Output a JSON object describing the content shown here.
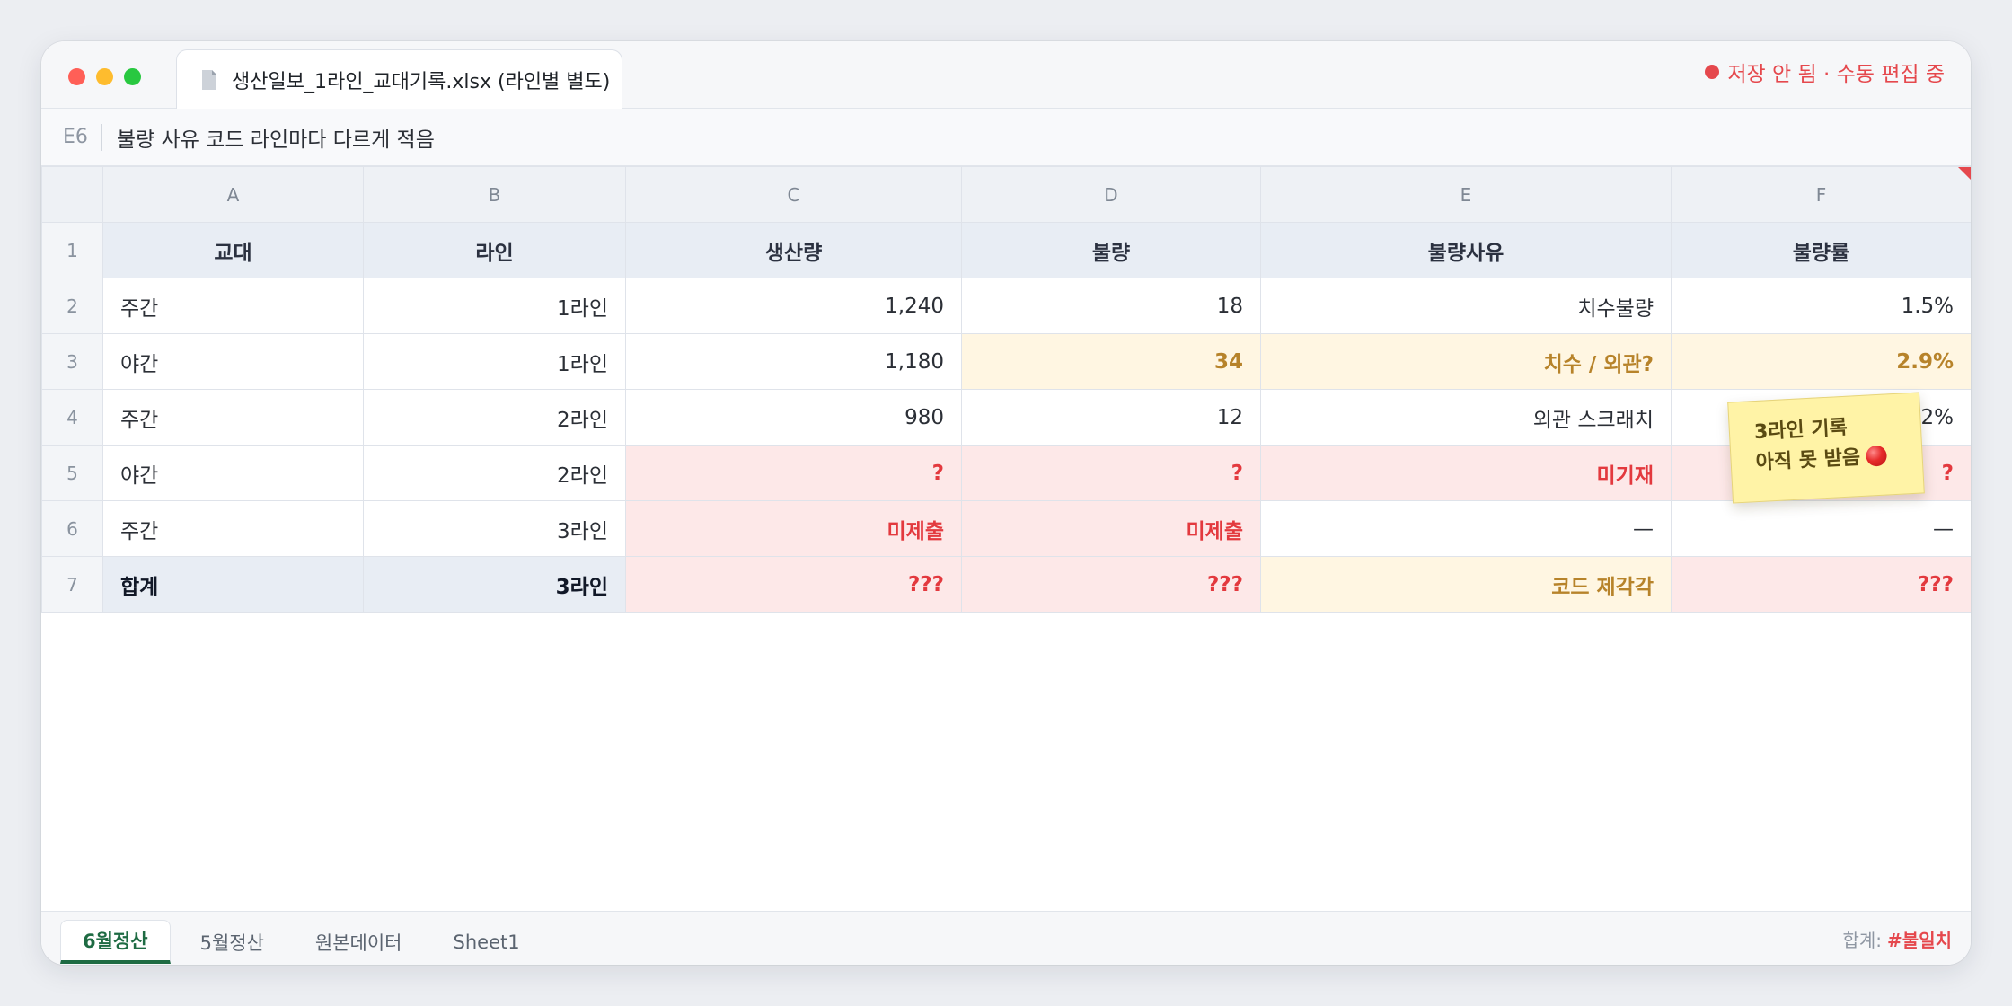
{
  "window": {
    "tab_title": "생산일보_1라인_교대기록.xlsx (라인별 별도)",
    "status": "저장 안 됨 · 수동 편집 중"
  },
  "formula_bar": {
    "cell_ref": "E6",
    "content": "불량 사유 코드 라인마다 다르게 적음"
  },
  "grid": {
    "columns": [
      "A",
      "B",
      "C",
      "D",
      "E",
      "F"
    ],
    "rows": [
      {
        "num": "1",
        "cells": [
          "교대",
          "라인",
          "생산량",
          "불량",
          "불량사유",
          "불량률"
        ]
      },
      {
        "num": "2",
        "cells": [
          "주간",
          "1라인",
          "1,240",
          "18",
          "치수불량",
          "1.5%"
        ]
      },
      {
        "num": "3",
        "cells": [
          "야간",
          "1라인",
          "1,180",
          "34",
          "치수 / 외관?",
          "2.9%"
        ]
      },
      {
        "num": "4",
        "cells": [
          "주간",
          "2라인",
          "980",
          "12",
          "외관 스크래치",
          "2%"
        ]
      },
      {
        "num": "5",
        "cells": [
          "야간",
          "2라인",
          "?",
          "?",
          "미기재",
          "?"
        ]
      },
      {
        "num": "6",
        "cells": [
          "주간",
          "3라인",
          "미제출",
          "미제출",
          "—",
          "—"
        ]
      },
      {
        "num": "7",
        "cells": [
          "합계",
          "3라인",
          "???",
          "???",
          "코드 제각각",
          "???"
        ]
      }
    ]
  },
  "sticky_note": {
    "line1": "3라인 기록",
    "line2": "아직 못 받음"
  },
  "sheet_tabs": [
    "6월정산",
    "5월정산",
    "원본데이터",
    "Sheet1"
  ],
  "footer": {
    "sum_label": "합계:",
    "sum_value": "#불일치"
  },
  "icons": {
    "tab": "file-icon",
    "status": "red-dot-icon",
    "note": "red-circle-icon",
    "cell_comment": "comment-indicator-icon"
  },
  "colors": {
    "error_bg": "#fde8e8",
    "error_text": "#e3393e",
    "warn_bg": "#fff6e2",
    "warn_text": "#b7832a",
    "header_bg": "#e8edf4",
    "accent_green": "#1e6b43",
    "status_red": "#e5484d",
    "note_bg": "#fff3a6"
  }
}
